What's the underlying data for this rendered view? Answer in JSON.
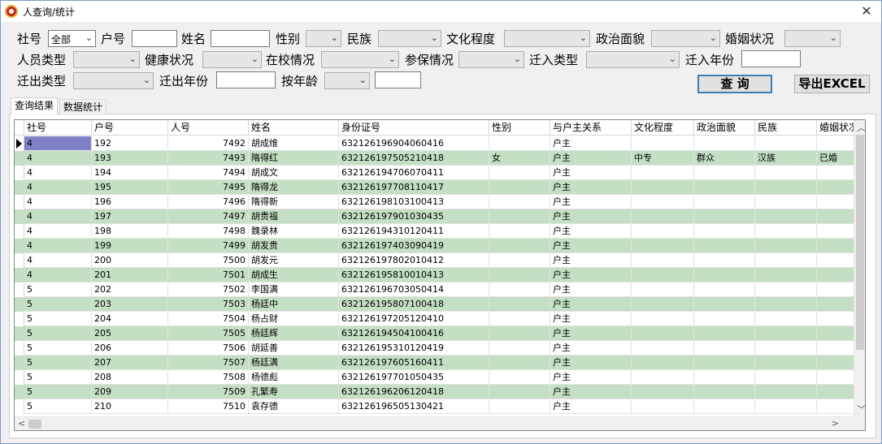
{
  "window": {
    "title": "人查询/统计",
    "close": "✕"
  },
  "filters": {
    "she_hao": {
      "label": "社号",
      "value": "全部"
    },
    "hu_hao": {
      "label": "户号",
      "value": ""
    },
    "name": {
      "label": "姓名",
      "value": ""
    },
    "gender": {
      "label": "性别",
      "value": ""
    },
    "ethnicity": {
      "label": "民族",
      "value": ""
    },
    "education": {
      "label": "文化程度",
      "value": ""
    },
    "political": {
      "label": "政治面貌",
      "value": ""
    },
    "marital": {
      "label": "婚姻状况",
      "value": ""
    },
    "person_type": {
      "label": "人员类型",
      "value": ""
    },
    "health": {
      "label": "健康状况",
      "value": ""
    },
    "school": {
      "label": "在校情况",
      "value": ""
    },
    "insurance": {
      "label": "参保情况",
      "value": ""
    },
    "move_in_type": {
      "label": "迁入类型",
      "value": ""
    },
    "move_in_year": {
      "label": "迁入年份",
      "value": ""
    },
    "move_out_type": {
      "label": "迁出类型",
      "value": ""
    },
    "move_out_year": {
      "label": "迁出年份",
      "value": ""
    },
    "by_age": {
      "label": "按年龄",
      "value": "",
      "value2": ""
    }
  },
  "buttons": {
    "query": "查 询",
    "export": "导出EXCEL"
  },
  "tabs": [
    {
      "label": "查询结果"
    },
    {
      "label": "数据统计"
    }
  ],
  "grid": {
    "columns": [
      "社号",
      "户号",
      "人号",
      "姓名",
      "身份证号",
      "性别",
      "与户主关系",
      "文化程度",
      "政治面貌",
      "民族",
      "婚姻状况"
    ],
    "rows": [
      [
        "4",
        "192",
        "7492",
        "胡成维",
        "632126196904060416",
        "",
        "户主",
        "",
        "",
        "",
        ""
      ],
      [
        "4",
        "193",
        "7493",
        "隋得红",
        "632126197505210418",
        "女",
        "户主",
        "中专",
        "群众",
        "汉族",
        "已婚"
      ],
      [
        "4",
        "194",
        "7494",
        "胡成文",
        "632126194706070411",
        "",
        "户主",
        "",
        "",
        "",
        ""
      ],
      [
        "4",
        "195",
        "7495",
        "隋得龙",
        "632126197708110417",
        "",
        "户主",
        "",
        "",
        "",
        ""
      ],
      [
        "4",
        "196",
        "7496",
        "隋得新",
        "632126198103100413",
        "",
        "户主",
        "",
        "",
        "",
        ""
      ],
      [
        "4",
        "197",
        "7497",
        "胡贵福",
        "632126197901030435",
        "",
        "户主",
        "",
        "",
        "",
        ""
      ],
      [
        "4",
        "198",
        "7498",
        "魏录林",
        "632126194310120411",
        "",
        "户主",
        "",
        "",
        "",
        ""
      ],
      [
        "4",
        "199",
        "7499",
        "胡发贵",
        "632126197403090419",
        "",
        "户主",
        "",
        "",
        "",
        ""
      ],
      [
        "4",
        "200",
        "7500",
        "胡发元",
        "632126197802010412",
        "",
        "户主",
        "",
        "",
        "",
        ""
      ],
      [
        "4",
        "201",
        "7501",
        "胡成生",
        "632126195810010413",
        "",
        "户主",
        "",
        "",
        "",
        ""
      ],
      [
        "5",
        "202",
        "7502",
        "李国满",
        "632126196703050414",
        "",
        "户主",
        "",
        "",
        "",
        ""
      ],
      [
        "5",
        "203",
        "7503",
        "杨廷中",
        "632126195807100418",
        "",
        "户主",
        "",
        "",
        "",
        ""
      ],
      [
        "5",
        "204",
        "7504",
        "杨占财",
        "632126197205120410",
        "",
        "户主",
        "",
        "",
        "",
        ""
      ],
      [
        "5",
        "205",
        "7505",
        "杨廷辉",
        "632126194504100416",
        "",
        "户主",
        "",
        "",
        "",
        ""
      ],
      [
        "5",
        "206",
        "7506",
        "胡延善",
        "632126195310120419",
        "",
        "户主",
        "",
        "",
        "",
        ""
      ],
      [
        "5",
        "207",
        "7507",
        "杨廷满",
        "632126197605160411",
        "",
        "户主",
        "",
        "",
        "",
        ""
      ],
      [
        "5",
        "208",
        "7508",
        "杨德彪",
        "632126197701050435",
        "",
        "户主",
        "",
        "",
        "",
        ""
      ],
      [
        "5",
        "209",
        "7509",
        "孔繁寿",
        "632126196206120418",
        "",
        "户主",
        "",
        "",
        "",
        ""
      ],
      [
        "5",
        "210",
        "7510",
        "袁存德",
        "632126196505130421",
        "",
        "户主",
        "",
        "",
        "",
        ""
      ]
    ]
  },
  "icons": {
    "dropdown": "chevron-down-icon",
    "row_pointer": "triangle-right-icon"
  },
  "colors": {
    "alt_row": "#c5dfc5",
    "selected": "#8080c8"
  }
}
